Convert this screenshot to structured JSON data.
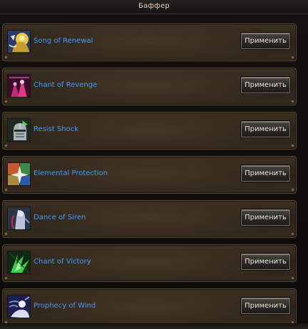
{
  "window": {
    "title": "Баффер"
  },
  "buffs": [
    {
      "name": "Song of Renewal",
      "button": "Применить",
      "icon": "renewal-song-icon",
      "color": "#e2c23a"
    },
    {
      "name": "Chant of Revenge",
      "button": "Применить",
      "icon": "revenge-chant-icon",
      "color": "#b8287a"
    },
    {
      "name": "Resist Shock",
      "button": "Применить",
      "icon": "knight-helmet-icon",
      "color": "#9aa6a8"
    },
    {
      "name": "Elemental Protection",
      "button": "Применить",
      "icon": "elemental-cross-icon",
      "color": "#d06a3a"
    },
    {
      "name": "Dance of Siren",
      "button": "Применить",
      "icon": "siren-dance-icon",
      "color": "#7a8cb0"
    },
    {
      "name": "Chant of Victory",
      "button": "Применить",
      "icon": "victory-chant-icon",
      "color": "#3ab840"
    },
    {
      "name": "Prophecy of Wind",
      "button": "Применить",
      "icon": "wind-prophecy-icon",
      "color": "#5a6ab8"
    }
  ],
  "colors": {
    "skill_text": "#3f9cff",
    "panel_border": "#5a4835",
    "button_text": "#e8e4de"
  }
}
